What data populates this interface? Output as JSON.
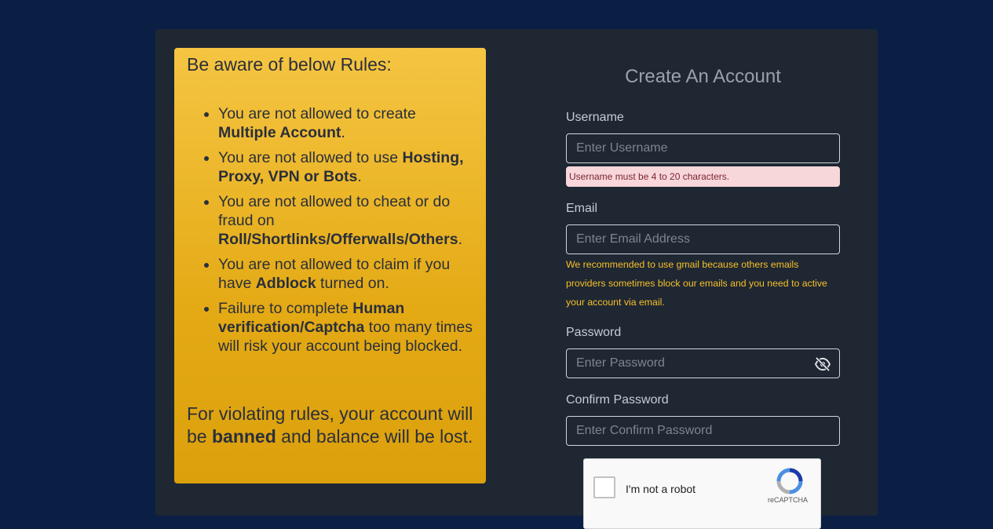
{
  "rules": {
    "title": "Be aware of below Rules:",
    "items": [
      {
        "pre": "You are not allowed to create ",
        "bold": "Multiple Account",
        "post": "."
      },
      {
        "pre": "You are not allowed to use ",
        "bold": "Hosting, Proxy, VPN or Bots",
        "post": "."
      },
      {
        "pre": "You are not allowed to cheat or do fraud on ",
        "bold": "Roll/Shortlinks/Offerwalls/Others",
        "post": "."
      },
      {
        "pre": "You are not allowed to claim if you have ",
        "bold": "Adblock",
        "post": " turned on."
      },
      {
        "pre": "Failure to complete ",
        "bold": "Human verification/Captcha",
        "post": " too many times will risk your account being blocked."
      }
    ],
    "footer": {
      "pre": "For violating rules, your account will be ",
      "bold": "banned",
      "post": " and balance will be lost."
    }
  },
  "form": {
    "title": "Create An Account",
    "username": {
      "label": "Username",
      "placeholder": "Enter Username",
      "error": "Username must be 4 to 20 characters."
    },
    "email": {
      "label": "Email",
      "placeholder": "Enter Email Address",
      "note": "We recommended to use gmail because others emails providers sometimes block our emails and you need to active your account via email."
    },
    "password": {
      "label": "Password",
      "placeholder": "Enter Password",
      "toggle_icon": "eye-slash-icon"
    },
    "confirm": {
      "label": "Confirm Password",
      "placeholder": "Enter Confirm Password"
    },
    "captcha": {
      "label": "I'm not a robot",
      "brand": "reCAPTCHA"
    }
  },
  "colors": {
    "page_bg": "#0b1f44",
    "card_bg": "#1f2733",
    "rules_gradient_top": "#f5c542",
    "rules_gradient_bottom": "#dba00c",
    "note_text": "#f6c028",
    "error_bg": "#f8d7da"
  }
}
